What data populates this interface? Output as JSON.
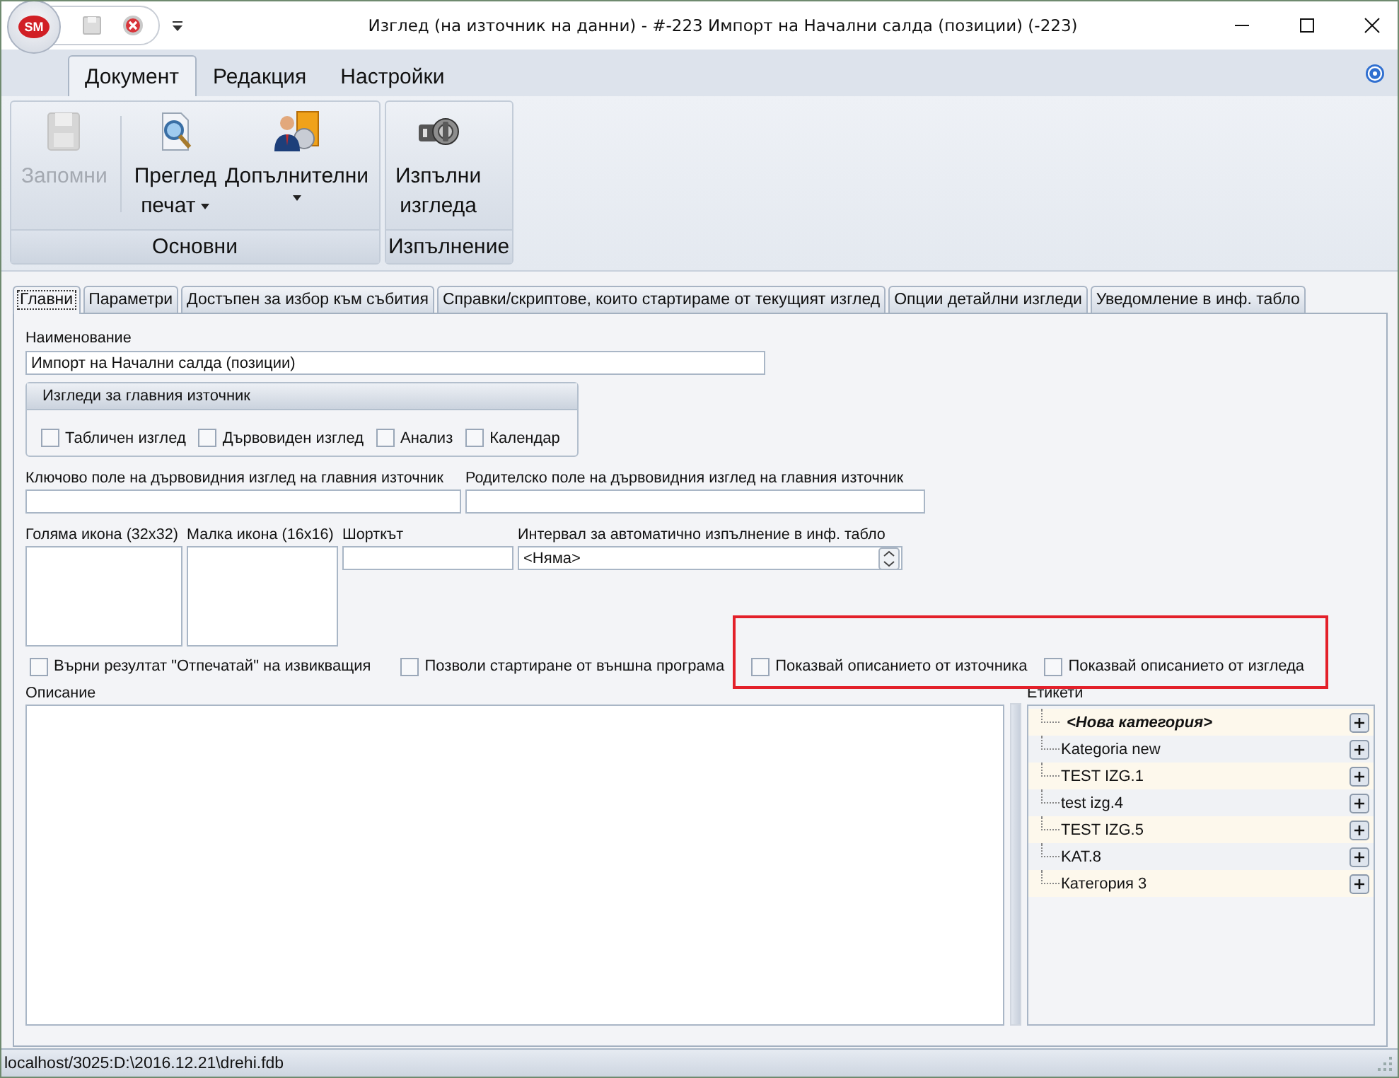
{
  "window": {
    "title": "Изглед (на източник на данни) - #-223 Импорт на Начални салда (позиции) (-223)",
    "logo": "SM"
  },
  "ribbon": {
    "tabs": [
      {
        "label": "Документ",
        "selected": true
      },
      {
        "label": "Редакция",
        "selected": false
      },
      {
        "label": "Настройки",
        "selected": false
      }
    ],
    "groups": [
      {
        "label": "Основни",
        "buttons": [
          {
            "kind": "save",
            "lines": [
              "Запомни"
            ],
            "disabled": true,
            "dropdown": false
          },
          {
            "kind": "preview",
            "lines": [
              "Преглед",
              "печат"
            ],
            "disabled": false,
            "dropdown": true
          },
          {
            "kind": "extra",
            "lines": [
              "Допълнителни"
            ],
            "disabled": false,
            "dropdown": true
          }
        ]
      },
      {
        "label": "Изпълнение",
        "buttons": [
          {
            "kind": "run",
            "lines": [
              "Изпълни",
              "изгледа"
            ],
            "disabled": false,
            "dropdown": false
          }
        ]
      }
    ]
  },
  "page_tabs": [
    {
      "label": "Главни",
      "selected": true
    },
    {
      "label": "Параметри",
      "selected": false
    },
    {
      "label": "Достъпен за избор към събития",
      "selected": false
    },
    {
      "label": "Справки/скриптове, които стартираме от текущият изглед",
      "selected": false
    },
    {
      "label": "Опции детайлни изгледи",
      "selected": false
    },
    {
      "label": "Уведомление в инф. табло",
      "selected": false
    }
  ],
  "form": {
    "name_label": "Наименование",
    "name_value": "Импорт на Начални салда (позиции)",
    "views_group": {
      "title": "Изгледи за главния източник",
      "options": [
        {
          "label": "Табличен изглед",
          "checked": false
        },
        {
          "label": "Дървовиден изглед",
          "checked": false
        },
        {
          "label": "Анализ",
          "checked": false
        },
        {
          "label": "Календар",
          "checked": false
        }
      ]
    },
    "key_field_label": "Ключово поле на дървовидния изглед на главния източник",
    "parent_field_label": "Родителско поле на дървовидния изглед на главния източник",
    "large_icon_label": "Голяма икона (32x32)",
    "small_icon_label": "Малка икона (16x16)",
    "shortcut_label": "Шорткът",
    "interval_label": "Интервал за автоматично изпълнение в инф. табло",
    "interval_value": "<Няма>",
    "options": [
      {
        "label": "Върни резултат \"Отпечатай\" на извикващия",
        "checked": false,
        "highlighted": false
      },
      {
        "label": "Позволи стартиране от външна програма",
        "checked": false,
        "highlighted": false
      },
      {
        "label": "Показвай описанието от източника",
        "checked": false,
        "highlighted": true
      },
      {
        "label": "Показвай описанието от изгледа",
        "checked": false,
        "highlighted": true
      }
    ],
    "description_label": "Описание",
    "tags_label": "Етикети",
    "tags": [
      {
        "label": "<Нова категория>",
        "kind": "new"
      },
      {
        "label": "Kategoria new",
        "kind": "item"
      },
      {
        "label": "TEST IZG.1",
        "kind": "item"
      },
      {
        "label": "test izg.4",
        "kind": "item"
      },
      {
        "label": "TEST IZG.5",
        "kind": "item"
      },
      {
        "label": "KAT.8",
        "kind": "item"
      },
      {
        "label": "Категория 3",
        "kind": "item"
      }
    ]
  },
  "status_bar": {
    "text": "localhost/3025:D:\\2016.12.21\\drehi.fdb"
  }
}
